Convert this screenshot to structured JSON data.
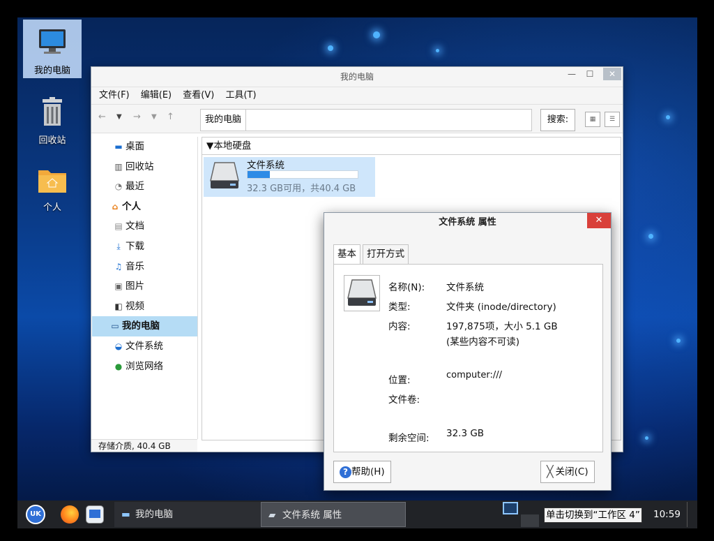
{
  "desktop": {
    "icons": [
      {
        "label": "我的电脑"
      },
      {
        "label": "回收站"
      },
      {
        "label": "个人"
      }
    ]
  },
  "file_manager": {
    "title": "我的电脑",
    "menu": [
      "文件(F)",
      "编辑(E)",
      "查看(V)",
      "工具(T)"
    ],
    "path": "我的电脑",
    "search_label": "搜索:",
    "sidebar": {
      "items": [
        {
          "label": "桌面",
          "icon": "desktop-icon"
        },
        {
          "label": "回收站",
          "icon": "trash-icon"
        },
        {
          "label": "最近",
          "icon": "clock-icon"
        },
        {
          "label": "个人",
          "icon": "home-icon"
        },
        {
          "label": "文档",
          "icon": "document-icon"
        },
        {
          "label": "下载",
          "icon": "download-icon"
        },
        {
          "label": "音乐",
          "icon": "music-icon"
        },
        {
          "label": "图片",
          "icon": "picture-icon"
        },
        {
          "label": "视频",
          "icon": "video-icon"
        },
        {
          "label": "我的电脑",
          "icon": "computer-icon"
        },
        {
          "label": "文件系统",
          "icon": "drive-icon"
        },
        {
          "label": "浏览网络",
          "icon": "network-icon"
        }
      ]
    },
    "section_title": "本地硬盘",
    "drive": {
      "name": "文件系统",
      "usage_fraction": 0.2,
      "info": "32.3 GB可用，共40.4 GB"
    },
    "status": "存储介质, 40.4 GB"
  },
  "properties_dialog": {
    "title": "文件系统 属性",
    "tabs": [
      "基本",
      "打开方式"
    ],
    "name_label": "名称(N):",
    "name_value": "文件系统",
    "type_label": "类型:",
    "type_value": "文件夹 (inode/directory)",
    "contents_label": "内容:",
    "contents_value": "197,875项，大小 5.1 GB",
    "contents_note": "(某些内容不可读)",
    "location_label": "位置:",
    "location_value": "computer:///",
    "volume_label": "文件卷:",
    "free_label": "剩余空间:",
    "free_value": "32.3 GB",
    "help_button": "帮助(H)",
    "close_button": "关闭(C)"
  },
  "taskbar": {
    "tasks": [
      "我的电脑",
      "文件系统 属性"
    ],
    "tooltip": "单击切换到“工作区 4”",
    "clock": "10:59"
  }
}
